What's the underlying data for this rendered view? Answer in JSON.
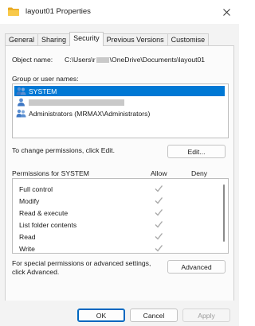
{
  "window": {
    "title": "layout01 Properties"
  },
  "tabs": [
    "General",
    "Sharing",
    "Security",
    "Previous Versions",
    "Customise"
  ],
  "active_tab": "Security",
  "object": {
    "label": "Object name:",
    "path_prefix": "C:\\Users\\r",
    "path_suffix": "\\OneDrive\\Documents\\layout01"
  },
  "users": {
    "label": "Group or user names:",
    "items": [
      {
        "name": "SYSTEM",
        "selected": true
      },
      {
        "name": "",
        "redacted": true
      },
      {
        "name": "Administrators (MRMAX\\Administrators)"
      }
    ]
  },
  "change_permissions": {
    "text": "To change permissions, click Edit.",
    "edit_label": "Edit..."
  },
  "permissions": {
    "label": "Permissions for SYSTEM",
    "allow_header": "Allow",
    "deny_header": "Deny",
    "rows": [
      {
        "name": "Full control",
        "allow": true,
        "deny": false
      },
      {
        "name": "Modify",
        "allow": true,
        "deny": false
      },
      {
        "name": "Read & execute",
        "allow": true,
        "deny": false
      },
      {
        "name": "List folder contents",
        "allow": true,
        "deny": false
      },
      {
        "name": "Read",
        "allow": true,
        "deny": false
      },
      {
        "name": "Write",
        "allow": true,
        "deny": false
      }
    ]
  },
  "advanced": {
    "text_line1": "For special permissions or advanced settings,",
    "text_line2": "click Advanced.",
    "button_label": "Advanced"
  },
  "footer": {
    "ok_label": "OK",
    "cancel_label": "Cancel",
    "apply_label": "Apply"
  },
  "colors": {
    "selection": "#0078d4",
    "checkmark": "#a8a8a8"
  }
}
